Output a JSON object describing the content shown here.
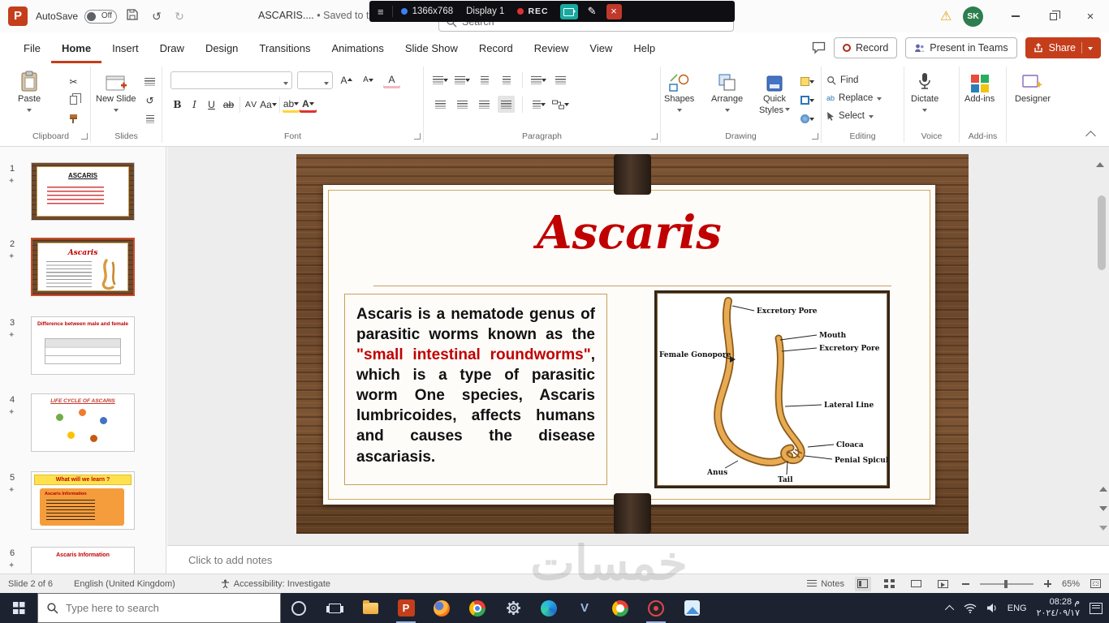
{
  "icons": {
    "ppt": "P",
    "close": "×",
    "warning": "⚠",
    "menu": "≡",
    "pencil": "✎",
    "undo": "↺",
    "redo": "↻",
    "cut": "✂",
    "star": "✦",
    "v_app": "V",
    "sep_dot": "•",
    "a": "A",
    "bold": "B",
    "italic": "I",
    "underline": "U",
    "strike": "ab",
    "spacing": "AV",
    "case": "Aa",
    "replace": "ab"
  },
  "recorder": {
    "resolution": "1366x768",
    "display": "Display 1",
    "rec": "REC"
  },
  "titlebar": {
    "autosave": "AutoSave",
    "autosave_state": "Off",
    "doc": "ASCARIS....",
    "saved": "Saved to this PC",
    "search": "Search",
    "avatar": "SK"
  },
  "tabs": [
    "File",
    "Home",
    "Insert",
    "Draw",
    "Design",
    "Transitions",
    "Animations",
    "Slide Show",
    "Record",
    "Review",
    "View",
    "Help"
  ],
  "actions": {
    "record": "Record",
    "teams": "Present in Teams",
    "share": "Share"
  },
  "ribbon": {
    "paste": "Paste",
    "new_slide": "New Slide",
    "shapes": "Shapes",
    "arrange": "Arrange",
    "quick": "Quick",
    "styles": "Styles",
    "find": "Find",
    "replace": "Replace",
    "select": "Select",
    "dictate": "Dictate",
    "designer": "Designer",
    "groups": {
      "clipboard": "Clipboard",
      "slides": "Slides",
      "font": "Font",
      "paragraph": "Paragraph",
      "drawing": "Drawing",
      "editing": "Editing",
      "voice": "Voice",
      "addins": "Add-ins"
    }
  },
  "slides_panel": [
    {
      "num": "1",
      "title": "ASCARIS"
    },
    {
      "num": "2",
      "title": "Ascaris"
    },
    {
      "num": "3",
      "title": "Difference between male and female"
    },
    {
      "num": "4",
      "title": "LIFE CYCLE OF ASCARIS"
    },
    {
      "num": "5",
      "title": "What will we learn ?",
      "box_title": "Ascaris Information"
    },
    {
      "num": "6",
      "title": "Ascaris Information"
    }
  ],
  "slide": {
    "title": "Ascaris",
    "body_pre": "Ascaris is a nematode genus of parasitic worms known as the ",
    "body_red": "\"small intestinal roundworms\"",
    "body_post": ", which is a type of parasitic worm One species, Ascaris lumbricoides, affects humans and causes the disease ascariasis.",
    "labels": [
      "Excretory Pore",
      "Mouth",
      "Excretory Pore",
      "Female Gonopore",
      "Lateral Line",
      "Cloaca",
      "Penial Spicules",
      "Anus",
      "Tail"
    ]
  },
  "notes": {
    "placeholder": "Click to add notes"
  },
  "status": {
    "slide": "Slide 2 of 6",
    "lang": "English (United Kingdom)",
    "access": "Accessibility: Investigate",
    "notes": "Notes",
    "zoom": "65%"
  },
  "taskbar": {
    "search": "Type here to search",
    "lang": "ENG",
    "time": "08:28 م",
    "date": "٢٠٢٤/٠٩/١٧"
  },
  "watermark": "خمسات",
  "colors": {
    "accent": "#c43e1c",
    "title_red": "#c00000",
    "selected_thumb": "#d04a2b",
    "wood": "#6f4a2c"
  }
}
